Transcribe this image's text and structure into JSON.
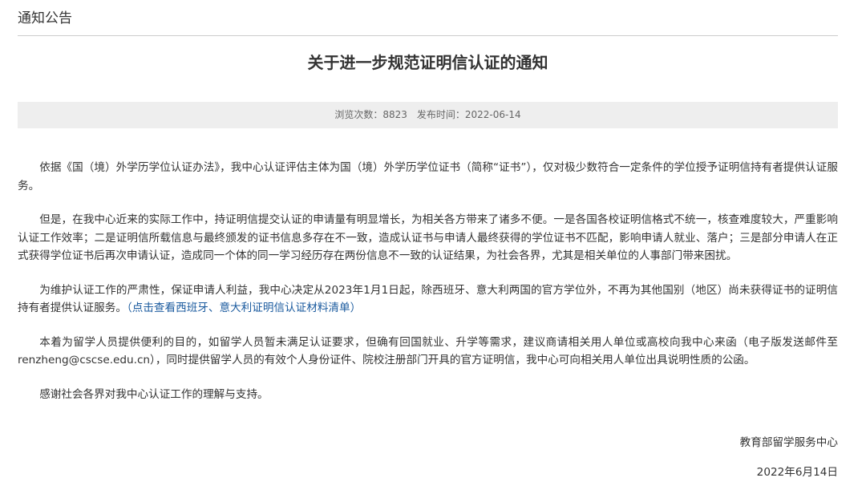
{
  "section": {
    "title": "通知公告"
  },
  "article": {
    "title": "关于进一步规范证明信认证的通知",
    "meta": {
      "views_label": "浏览次数：8823",
      "published_label": "发布时间：2022-06-14"
    },
    "paragraphs": [
      "依据《国（境）外学历学位认证办法》，我中心认证评估主体为国（境）外学历学位证书（简称“证书”），仅对极少数符合一定条件的学位授予证明信持有者提供认证服务。",
      "但是，在我中心近来的实际工作中，持证明信提交认证的申请量有明显增长，为相关各方带来了诸多不便。一是各国各校证明信格式不统一，核查难度较大，严重影响认证工作效率；二是证明信所载信息与最终颁发的证书信息多存在不一致，造成认证书与申请人最终获得的学位证书不匹配，影响申请人就业、落户；三是部分申请人在正式获得学位证书后再次申请认证，造成同一个体的同一学习经历存在两份信息不一致的认证结果，为社会各界，尤其是相关单位的人事部门带来困扰。",
      "为维护认证工作的严肃性，保证申请人利益，我中心决定从2023年1月1日起，除西班牙、意大利两国的官方学位外，不再为其他国别（地区）尚未获得证书的证明信持有者提供认证服务。",
      "本着为留学人员提供便利的目的，如留学人员暂未满足认证要求，但确有回国就业、升学等需求，建议商请相关用人单位或高校向我中心来函（电子版发送邮件至renzheng@cscse.edu.cn），同时提供留学人员的有效个人身份证件、院校注册部门开具的官方证明信，我中心可向相关用人单位出具说明性质的公函。",
      "感谢社会各界对我中心认证工作的理解与支持。"
    ],
    "link_text": "（点击查看西班牙、意大利证明信认证材料清单）",
    "signature": "教育部留学服务中心",
    "date": "2022年6月14日"
  },
  "colors": {
    "link": "#1a5a9e",
    "meta_background": "#eeeeee",
    "divider": "#cccccc"
  }
}
